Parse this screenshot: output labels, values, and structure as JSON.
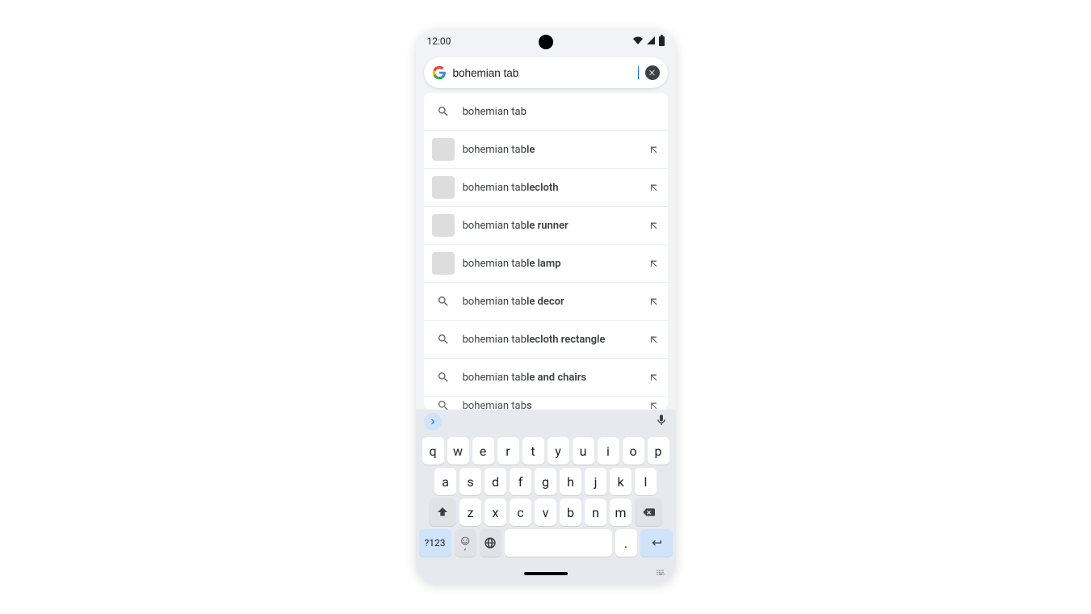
{
  "status": {
    "time": "12:00"
  },
  "search": {
    "query": "bohemian tab"
  },
  "suggestions": [
    {
      "prefix": "bohemian tab",
      "completion": "",
      "thumb": "search",
      "arrow": false
    },
    {
      "prefix": "bohemian tab",
      "completion": "le",
      "thumb": "th-table",
      "arrow": true
    },
    {
      "prefix": "bohemian tab",
      "completion": "lecloth",
      "thumb": "th-cloth",
      "arrow": true
    },
    {
      "prefix": "bohemian tab",
      "completion": "le runner",
      "thumb": "th-runner",
      "arrow": true
    },
    {
      "prefix": "bohemian tab",
      "completion": "le lamp",
      "thumb": "th-lamp",
      "arrow": true
    },
    {
      "prefix": "bohemian tab",
      "completion": "le decor",
      "thumb": "search",
      "arrow": true
    },
    {
      "prefix": "bohemian tab",
      "completion": "lecloth rectangle",
      "thumb": "search",
      "arrow": true
    },
    {
      "prefix": "bohemian tab",
      "completion": "le and chairs",
      "thumb": "search",
      "arrow": true
    },
    {
      "prefix": "bohemian tab",
      "completion": "s",
      "thumb": "search",
      "arrow": true,
      "clip": true
    }
  ],
  "keyboard": {
    "row1": [
      "q",
      "w",
      "e",
      "r",
      "t",
      "y",
      "u",
      "i",
      "o",
      "p"
    ],
    "row2": [
      "a",
      "s",
      "d",
      "f",
      "g",
      "h",
      "j",
      "k",
      "l"
    ],
    "row3": [
      "z",
      "x",
      "c",
      "v",
      "b",
      "n",
      "m"
    ],
    "num_label": "?123",
    "period": "."
  }
}
